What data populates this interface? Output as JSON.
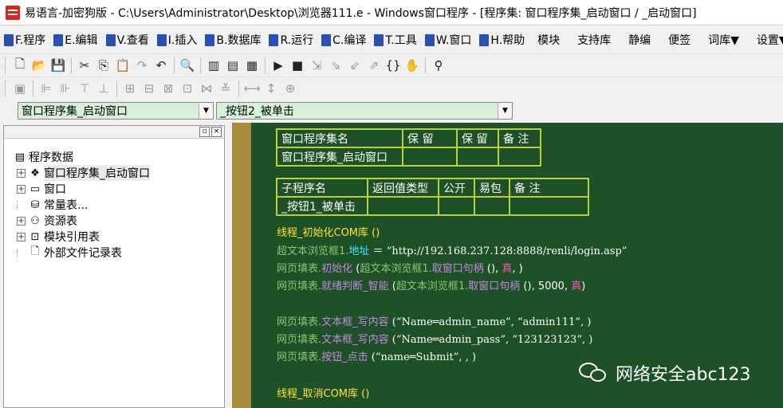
{
  "window": {
    "title": "易语言-加密狗版 - C:\\Users\\Administrator\\Desktop\\浏览器111.e - Windows窗口程序 - [程序集: 窗口程序集_启动窗口 / _启动窗口]"
  },
  "menu": {
    "items": [
      "F.程序",
      "E.编辑",
      "V.查看",
      "I.插入",
      "B.数据库",
      "R.运行",
      "C.编译",
      "T.工具",
      "W.窗口",
      "H.帮助"
    ],
    "right_items": [
      "模块",
      "支持库",
      "静编",
      "便签",
      "词库▼",
      "设置▼"
    ]
  },
  "toolbar1": {
    "icons": [
      "new-icon",
      "open-icon",
      "save-icon",
      "cut-icon",
      "copy-icon",
      "paste-icon",
      "redo-icon",
      "undo-icon",
      "find-icon",
      "layout1-icon",
      "layout2-icon",
      "layout3-icon",
      "run-icon",
      "stop-icon",
      "step1-icon",
      "step2-icon",
      "step3-icon",
      "step4-icon",
      "hand-icon",
      "binoculars-icon"
    ]
  },
  "combos": {
    "assembly": "窗口程序集_启动窗口",
    "subroutine": "_按钮2_被单击"
  },
  "tree": {
    "root": "程序数据",
    "items": [
      "窗口程序集_启动窗口",
      "窗口",
      "常量表...",
      "资源表",
      "模块引用表",
      "外部文件记录表"
    ]
  },
  "assembly_table": {
    "headers": [
      "窗口程序集名",
      "保 留",
      "保 留",
      "备 注"
    ],
    "row": [
      "窗口程序集_启动窗口",
      "",
      "",
      ""
    ]
  },
  "sub_table": {
    "headers": [
      "子程序名",
      "返回值类型",
      "公开",
      "易包",
      "备 注"
    ],
    "row": [
      "_按钮1_被单击",
      "",
      "",
      "",
      ""
    ]
  },
  "code": {
    "l1": "线程_初始化COM库 ()",
    "l2a": "超文本浏览框1.",
    "l2b": "地址",
    "l2c": " ＝ ",
    "l2d": "“http://192.168.237.128:8888/renli/login.asp”",
    "l3a": "网页填表.",
    "l3b": "初始化",
    "l3c": " (",
    "l3d": "超文本浏览框1.",
    "l3e": "取窗口句柄",
    "l3f": " (), ",
    "l3g": "真",
    "l3h": ", )",
    "l4a": "网页填表.",
    "l4b": "就绪判断_智能",
    "l4c": " (",
    "l4d": "超文本浏览框1.",
    "l4e": "取窗口句柄",
    "l4f": " (), 5000, ",
    "l4g": "真",
    "l4h": ")",
    "l5a": "网页填表.",
    "l5b": "文本框_写内容",
    "l5c": " (“Name═admin_name”, “admin111”, )",
    "l6a": "网页填表.",
    "l6b": "文本框_写内容",
    "l6c": " (“Name═admin_pass”, “123123123”, )",
    "l7a": "网页填表.",
    "l7b": "按钮_点击",
    "l7c": " (“name═Submit”, , )",
    "l8": "线程_取消COM库 ()"
  },
  "watermark": {
    "text": "网络安全abc123"
  }
}
